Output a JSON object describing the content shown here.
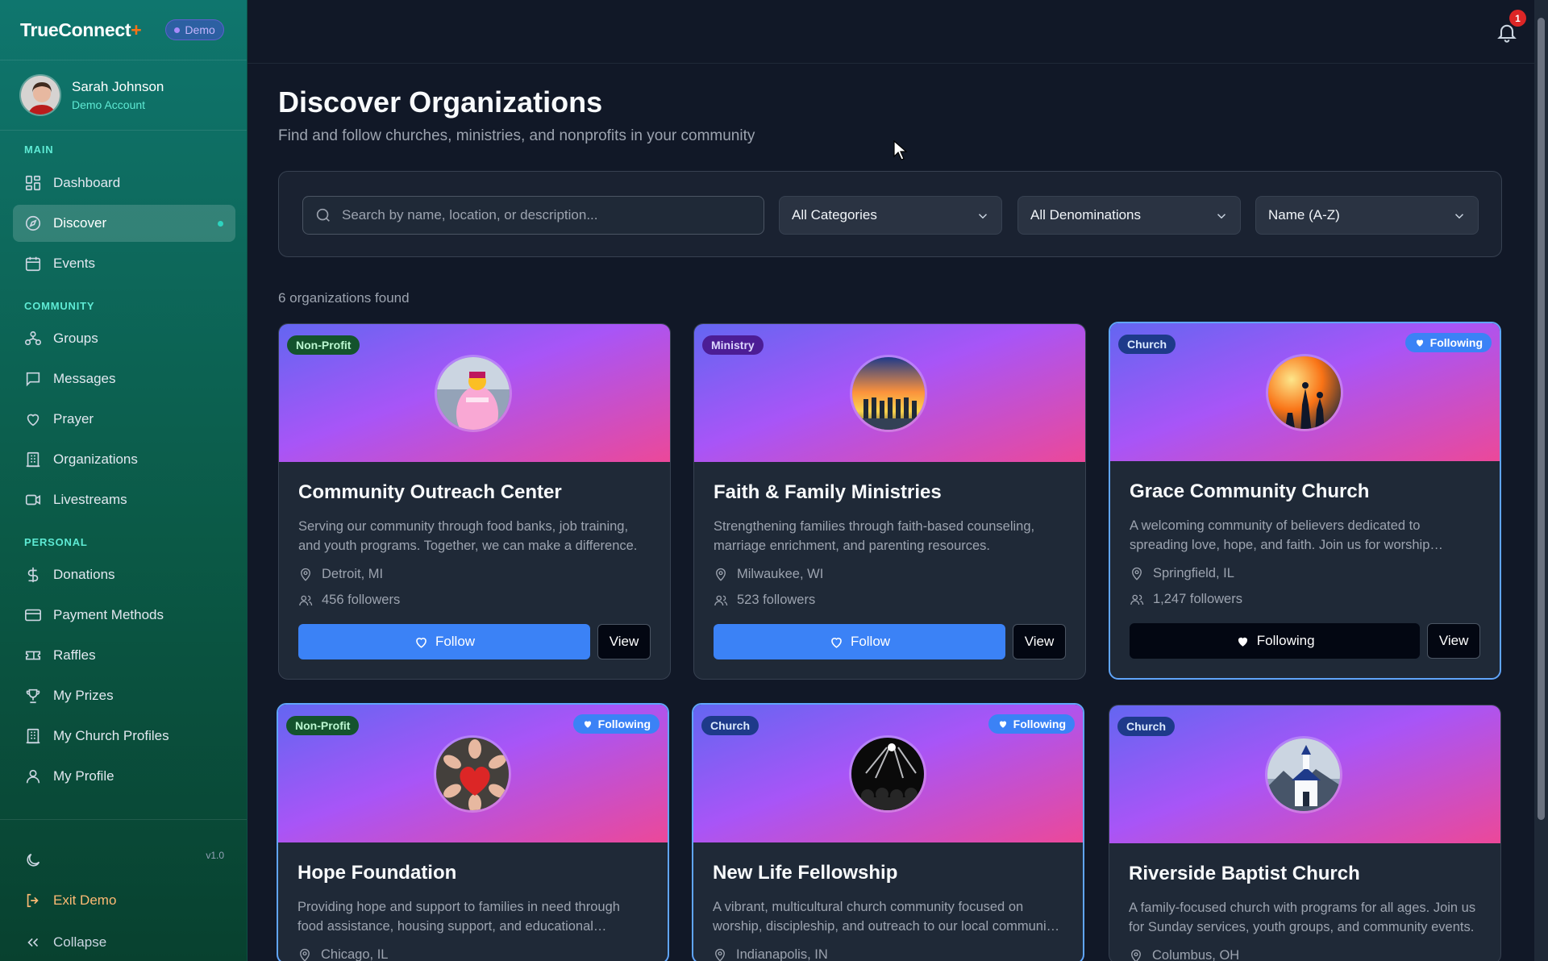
{
  "app": {
    "brand": "TrueConnect",
    "brand_plus": "+",
    "demo_badge": "Demo",
    "version": "v1.0"
  },
  "user": {
    "name": "Sarah Johnson",
    "account": "Demo Account"
  },
  "sidebar": {
    "sections": {
      "main": "MAIN",
      "community": "COMMUNITY",
      "personal": "PERSONAL"
    },
    "items": [
      {
        "label": "Dashboard",
        "icon": "dashboard-icon"
      },
      {
        "label": "Discover",
        "icon": "compass-icon",
        "active": true
      },
      {
        "label": "Events",
        "icon": "calendar-icon"
      },
      {
        "label": "Groups",
        "icon": "groups-icon"
      },
      {
        "label": "Messages",
        "icon": "message-icon"
      },
      {
        "label": "Prayer",
        "icon": "heart-icon"
      },
      {
        "label": "Organizations",
        "icon": "building-icon"
      },
      {
        "label": "Livestreams",
        "icon": "video-icon"
      },
      {
        "label": "Donations",
        "icon": "dollar-icon"
      },
      {
        "label": "Payment Methods",
        "icon": "credit-card-icon"
      },
      {
        "label": "Raffles",
        "icon": "ticket-icon"
      },
      {
        "label": "My Prizes",
        "icon": "trophy-icon"
      },
      {
        "label": "My Church Profiles",
        "icon": "building-icon"
      },
      {
        "label": "My Profile",
        "icon": "user-icon"
      }
    ],
    "footer": {
      "exit": "Exit Demo",
      "collapse": "Collapse"
    }
  },
  "topbar": {
    "notification_count": "1"
  },
  "main": {
    "title": "Discover Organizations",
    "subtitle": "Find and follow churches, ministries, and nonprofits in your community",
    "search": {
      "placeholder": "Search by name, location, or description..."
    },
    "filters": {
      "category": "All Categories",
      "denomination": "All Denominations",
      "sort": "Name (A-Z)"
    },
    "results_count": "6 organizations found",
    "follow_label": "Follow",
    "following_label": "Following",
    "view_label": "View",
    "orgs": [
      {
        "category": "Non-Profit",
        "name": "Community Outreach Center",
        "description": "Serving our community through food banks, job training, and youth programs. Together, we can make a difference.",
        "location": "Detroit, MI",
        "followers": "456 followers",
        "following": false
      },
      {
        "category": "Ministry",
        "name": "Faith & Family Ministries",
        "description": "Strengthening families through faith-based counseling, marriage enrichment, and parenting resources.",
        "location": "Milwaukee, WI",
        "followers": "523 followers",
        "following": false
      },
      {
        "category": "Church",
        "name": "Grace Community Church",
        "description": "A welcoming community of believers dedicated to spreading love, hope, and faith. Join us for worship…",
        "location": "Springfield, IL",
        "followers": "1,247 followers",
        "following": true
      },
      {
        "category": "Non-Profit",
        "name": "Hope Foundation",
        "description": "Providing hope and support to families in need through food assistance, housing support, and educational…",
        "location": "Chicago, IL",
        "following": true
      },
      {
        "category": "Church",
        "name": "New Life Fellowship",
        "description": "A vibrant, multicultural church community focused on worship, discipleship, and outreach to our local communi…",
        "location": "Indianapolis, IN",
        "following": true
      },
      {
        "category": "Church",
        "name": "Riverside Baptist Church",
        "description": "A family-focused church with programs for all ages. Join us for Sunday services, youth groups, and community events.",
        "location": "Columbus, OH",
        "following": false
      }
    ]
  }
}
